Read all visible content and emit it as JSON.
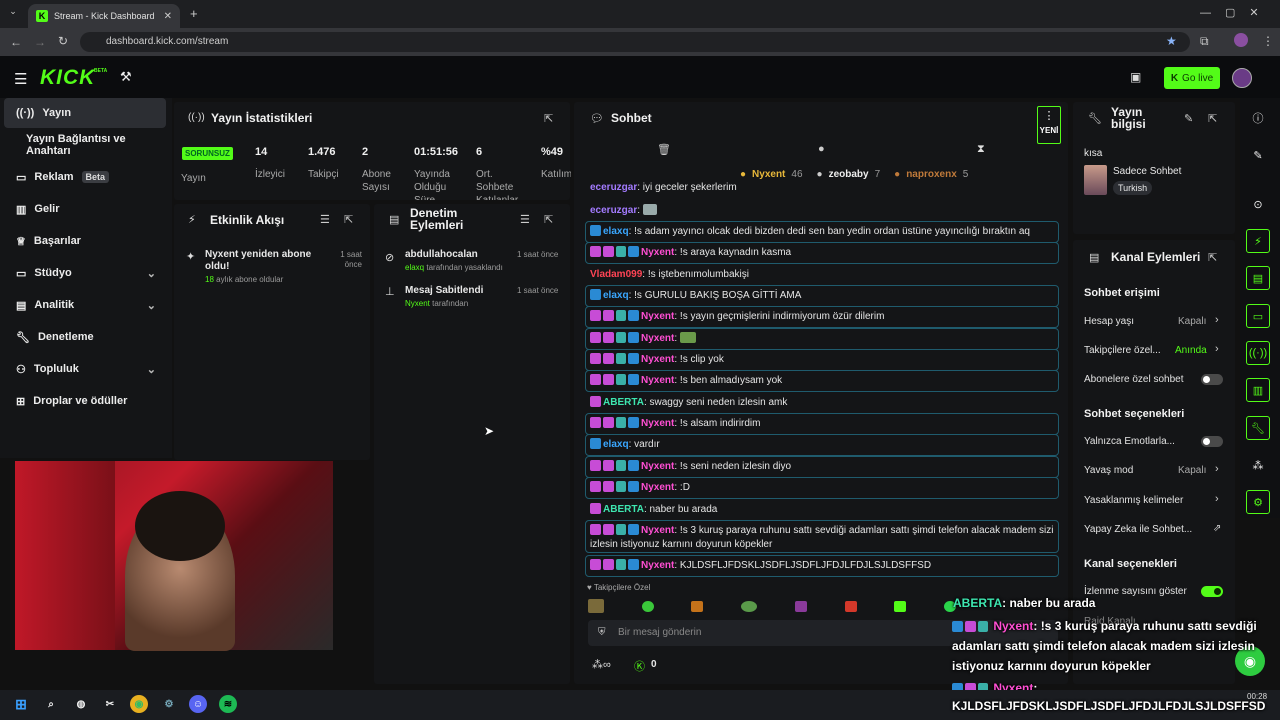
{
  "browser": {
    "tab_title": "Stream - Kick Dashboard",
    "url": "dashboard.kick.com/stream"
  },
  "header": {
    "logo": "KICK",
    "logo_super": "BETA",
    "go_live": "Go live"
  },
  "sidebar": {
    "items": [
      {
        "label": "Yayın"
      },
      {
        "label": "Yayın Bağlantısı ve Anahtarı"
      },
      {
        "label": "Reklam",
        "badge": "Beta"
      },
      {
        "label": "Gelir"
      },
      {
        "label": "Başarılar"
      },
      {
        "label": "Stüdyo"
      },
      {
        "label": "Analitik"
      },
      {
        "label": "Denetleme"
      },
      {
        "label": "Topluluk"
      },
      {
        "label": "Droplar ve ödüller"
      }
    ]
  },
  "stats": {
    "title": "Yayın İstatistikleri",
    "status_badge": "SORUNSUZ",
    "items": [
      {
        "label": "Yayın",
        "value": ""
      },
      {
        "label": "İzleyici",
        "value": "14"
      },
      {
        "label": "Takipçi",
        "value": "1.476"
      },
      {
        "label": "Abone Sayısı",
        "value": "2"
      },
      {
        "label": "Yayında Olduğu Süre",
        "value": "01:51:56"
      },
      {
        "label": "Ort. Sohbete Katılanlar",
        "value": "6"
      },
      {
        "label": "Katılım",
        "value": "%49"
      }
    ]
  },
  "activity": {
    "title": "Etkinlik Akışı",
    "events": [
      {
        "title": "Nyxent yeniden abone oldu!",
        "months": "18",
        "sub": "aylık abone oldular",
        "time": "1 saat önce"
      }
    ]
  },
  "moderation": {
    "title": "Denetim Eylemleri",
    "items": [
      {
        "user": "abdullahocalan",
        "actor": "elaxq",
        "detail": "tarafından yasaklandı",
        "time": "1 saat önce"
      },
      {
        "user": "Mesaj Sabitlendi",
        "actor": "Nyxent",
        "detail": "tarafından",
        "time": "1 saat önce"
      }
    ]
  },
  "chat": {
    "title": "Sohbet",
    "new_label": "YENİ",
    "top_gifters": [
      {
        "name": "Nyxent",
        "count": "46"
      },
      {
        "name": "zeobaby",
        "count": "7"
      },
      {
        "name": "naproxenx",
        "count": "5"
      }
    ],
    "messages": [
      {
        "user": "eceruzgar",
        "text": ": iyi geceler şekerlerim"
      },
      {
        "user": "eceruzgar",
        "text": ":"
      },
      {
        "user": "elaxq",
        "text": ": !s adam yayıncı olcak dedi bizden dedi sen ban yedin ordan üstüne yayıncılığı bıraktın aq"
      },
      {
        "user": "Nyxent",
        "text": ": !s araya kaynadın kasma"
      },
      {
        "user": "Vladam099",
        "text": ": !s iştebenımolumbakişi"
      },
      {
        "user": "elaxq",
        "text": ": !s GURULU BAKIŞ BOŞA GİTTİ AMA"
      },
      {
        "user": "Nyxent",
        "text": ": !s yayın geçmişlerini indirmiyorum özür dilerim"
      },
      {
        "user": "Nyxent",
        "text": ":"
      },
      {
        "user": "Nyxent",
        "text": ": !s clip yok"
      },
      {
        "user": "Nyxent",
        "text": ": !s ben almadıysam yok"
      },
      {
        "user": "ABERTA",
        "text": ": swaggy seni neden izlesin amk"
      },
      {
        "user": "Nyxent",
        "text": ": !s alsam indirirdim"
      },
      {
        "user": "elaxq",
        "text": ": vardır"
      },
      {
        "user": "Nyxent",
        "text": ": !s seni neden izlesin diyo"
      },
      {
        "user": "Nyxent",
        "text": ": :D"
      },
      {
        "user": "ABERTA",
        "text": ": naber bu arada"
      },
      {
        "user": "Nyxent",
        "text": ": !s 3 kuruş paraya ruhunu sattı sevdiği adamları sattı şimdi telefon alacak madem",
        "text2": "sizi izlesin istiyonuz karnını doyurun köpekler"
      },
      {
        "user": "Nyxent",
        "text": ": KJLDSFLJFDSKLJSDFLJSDFLJFDJLFDJLSJLDSFFSD"
      }
    ],
    "followers_only": "Takipçilere Özel",
    "input_placeholder": "Bir mesaj gönderin",
    "kicks_count": "0"
  },
  "stream_info": {
    "title": "Yayın bilgisi",
    "stream_title": "kısa",
    "category": "Sadece Sohbet",
    "tag": "Turkish"
  },
  "channel_actions": {
    "title": "Kanal Eylemleri",
    "chat_access": "Sohbet erişimi",
    "rows1": [
      {
        "label": "Hesap yaşı",
        "value": "Kapalı"
      },
      {
        "label": "Takipçilere özel...",
        "value": "Anında"
      },
      {
        "label": "Abonelere özel sohbet",
        "value": ""
      }
    ],
    "chat_options": "Sohbet seçenekleri",
    "rows2": [
      {
        "label": "Yalnızca Emotlarla...",
        "value": ""
      },
      {
        "label": "Yavaş mod",
        "value": "Kapalı"
      },
      {
        "label": "Yasaklanmış kelimeler",
        "value": ""
      },
      {
        "label": "Yapay Zeka ile Sohbet...",
        "value": ""
      }
    ],
    "channel_options": "Kanal seçenekleri",
    "rows3": [
      {
        "label": "İzlenme sayısını göster",
        "value": ""
      },
      {
        "label": "Raid Kanalı",
        "value": ""
      }
    ]
  },
  "overlay": {
    "lines": [
      {
        "user": "ABERTA",
        "text": ": naber bu arada"
      },
      {
        "user": "Nyxent",
        "text": ": !s 3 kuruş paraya ruhunu sattı sevdiği"
      },
      {
        "user": "",
        "text": "adamları sattı şimdi telefon alacak madem sizi izlesin"
      },
      {
        "user": "",
        "text": "istiyonuz karnını doyurun köpekler"
      },
      {
        "user": "Nyxent",
        "text": ":"
      },
      {
        "user": "",
        "text": "KJLDSFLJFDSKLJSDFLJSDFLJFDJLFDJLSJLDSFFSD"
      }
    ]
  },
  "taskbar": {
    "time": "00:28"
  },
  "colors": {
    "kick_green": "#53fc18",
    "nyxent": "#ff4fd3",
    "elaxq": "#3aa7ff",
    "eceruzgar": "#a37bff",
    "aberta": "#3ee6b0"
  }
}
